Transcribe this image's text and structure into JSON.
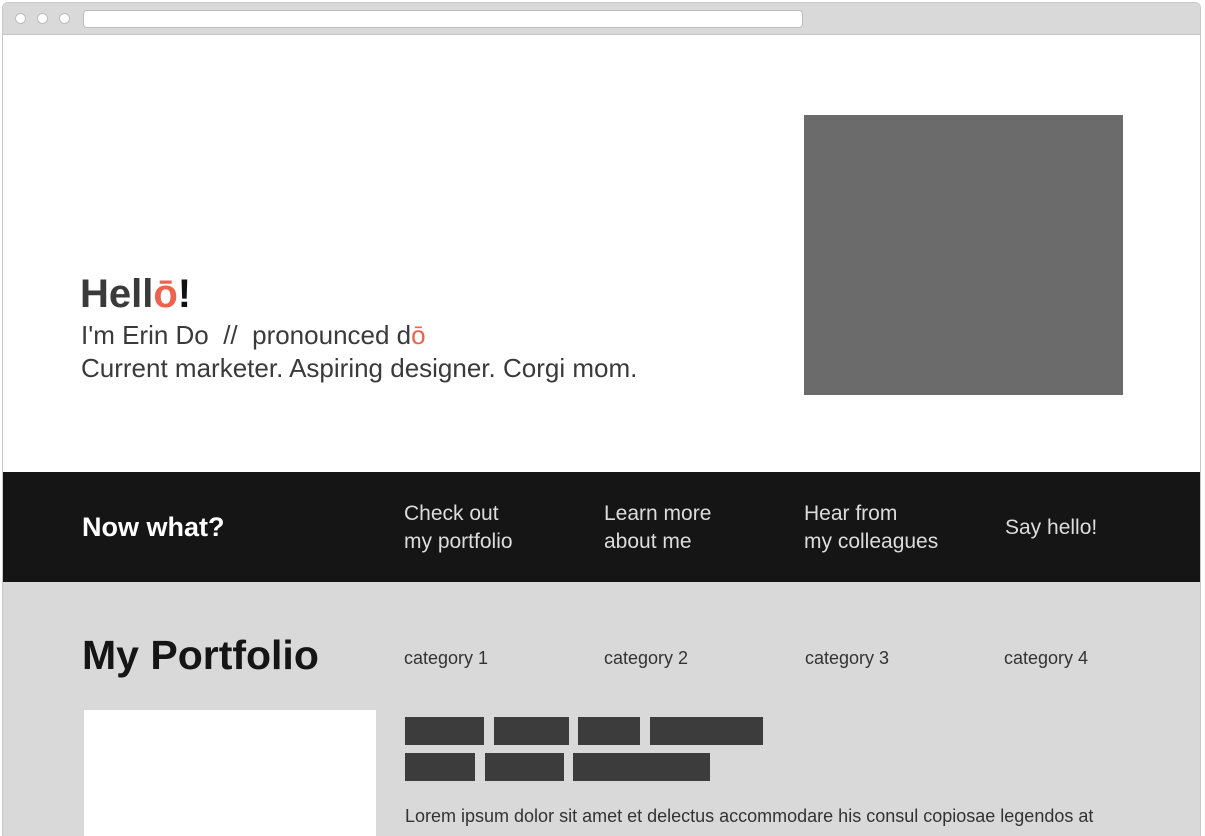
{
  "hero": {
    "title_prefix": "Hell",
    "title_accent": "ō",
    "title_suffix": "!",
    "intro_prefix": "I'm Erin Do  //  pronounced d",
    "intro_accent": "ō",
    "tagline": "Current marketer. Aspiring designer. Corgi mom."
  },
  "nav": {
    "heading": "Now what?",
    "links": [
      {
        "line1": "Check out",
        "line2": "my portfolio"
      },
      {
        "line1": "Learn more",
        "line2": "about me"
      },
      {
        "line1": "Hear from",
        "line2": "my colleagues"
      },
      {
        "line1": "Say hello!",
        "line2": ""
      }
    ]
  },
  "portfolio": {
    "title": "My Portfolio",
    "categories": [
      "category 1",
      "category 2",
      "category 3",
      "category 4"
    ],
    "description": "Lorem ipsum dolor sit amet et delectus accommodare his consul copiosae legendos at"
  },
  "colors": {
    "accent": "#f0624d",
    "nav_background": "#151515",
    "portfolio_background": "#d9d9d9",
    "photo_placeholder": "#6b6b6b",
    "tag_placeholder": "#3c3c3c"
  }
}
